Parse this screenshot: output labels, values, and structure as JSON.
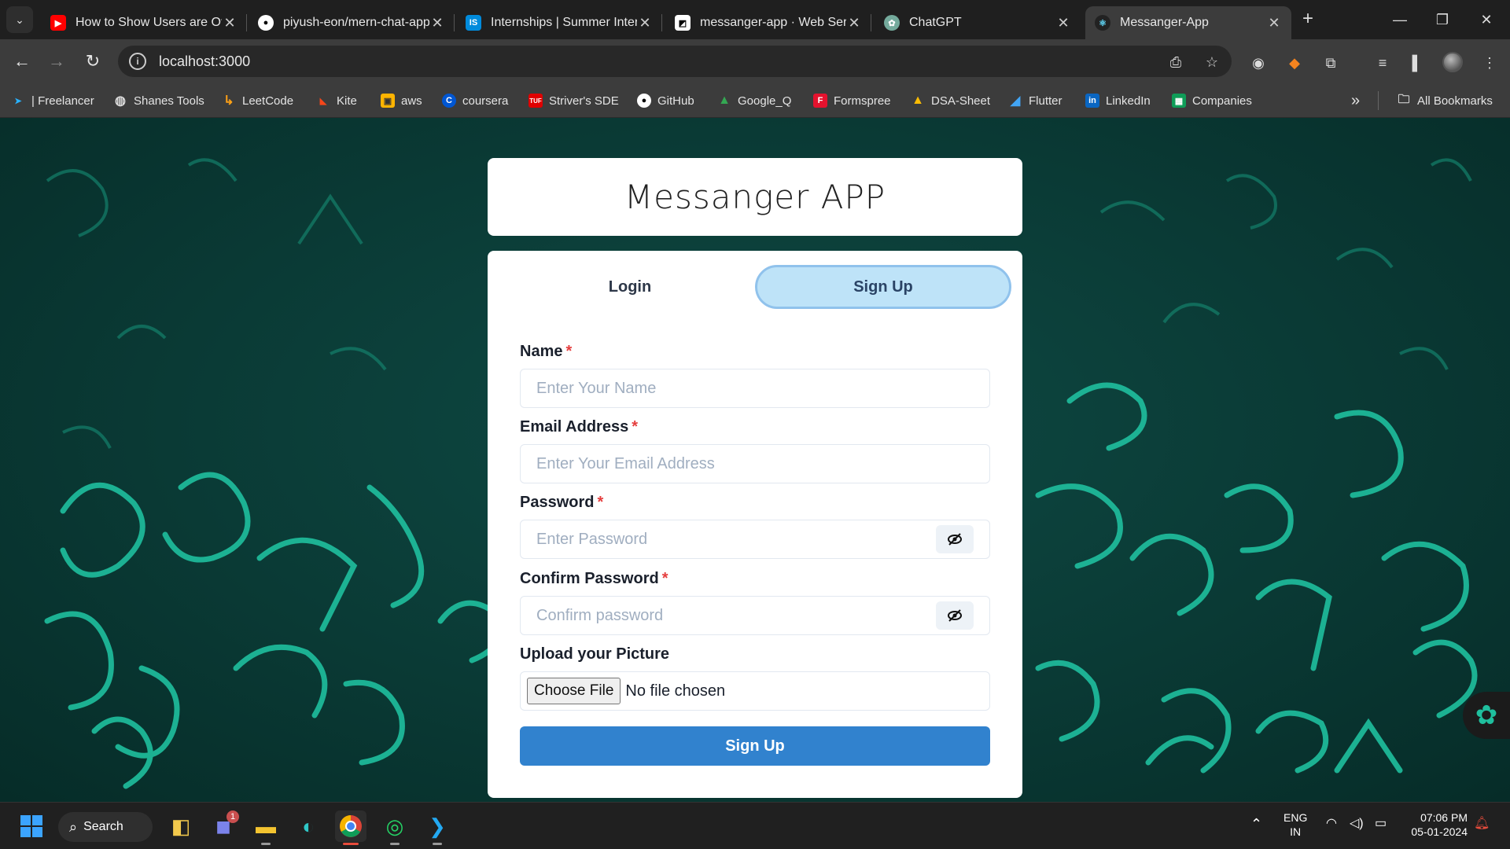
{
  "browser": {
    "tabs": [
      {
        "title": "How to Show Users are Offline",
        "favicon": "youtube-icon",
        "color": "#ff0000"
      },
      {
        "title": "piyush-eon/mern-chat-app",
        "favicon": "github-icon",
        "color": "#ffffff"
      },
      {
        "title": "Internships | Summer Internships",
        "favicon": "internshala-icon",
        "color": "#008bdc"
      },
      {
        "title": "messanger-app · Web Service",
        "favicon": "render-icon",
        "color": "#ffffff"
      },
      {
        "title": "ChatGPT",
        "favicon": "chatgpt-icon",
        "color": "#74aa9c"
      },
      {
        "title": "Messanger-App",
        "favicon": "react-icon",
        "color": "#61dafb",
        "active": true
      }
    ],
    "url": "localhost:3000",
    "bookmarks": [
      {
        "label": "| Freelancer",
        "icon": "freelancer-icon",
        "color": "#29b2fe"
      },
      {
        "label": "Shanes Tools",
        "icon": "globe-icon",
        "color": "#dddddd"
      },
      {
        "label": "LeetCode",
        "icon": "leetcode-icon",
        "color": "#ffa116"
      },
      {
        "label": "Kite",
        "icon": "kite-icon",
        "color": "#f6461a"
      },
      {
        "label": "aws",
        "icon": "aws-icon",
        "color": "#ffb400"
      },
      {
        "label": "coursera",
        "icon": "coursera-icon",
        "color": "#0056d2"
      },
      {
        "label": "Striver's SDE",
        "icon": "tuf-icon",
        "color": "#e00000"
      },
      {
        "label": "GitHub",
        "icon": "github-icon",
        "color": "#ffffff"
      },
      {
        "label": "Google_Q",
        "icon": "google-drive-icon",
        "color": "#34a853"
      },
      {
        "label": "Formspree",
        "icon": "formspree-icon",
        "color": "#e5122e"
      },
      {
        "label": "DSA-Sheet",
        "icon": "google-drive-icon",
        "color": "#fbbc04"
      },
      {
        "label": "Flutter",
        "icon": "flutter-icon",
        "color": "#42a5f5"
      },
      {
        "label": "LinkedIn",
        "icon": "linkedin-icon",
        "color": "#0a66c2"
      },
      {
        "label": "Companies",
        "icon": "sheets-icon",
        "color": "#0f9d58"
      }
    ],
    "all_bookmarks_label": "All Bookmarks",
    "overflow_label": "»"
  },
  "app": {
    "title": "Messanger APP",
    "tabs": {
      "login": "Login",
      "signup": "Sign Up"
    },
    "fields": {
      "name": {
        "label": "Name",
        "placeholder": "Enter Your Name"
      },
      "email": {
        "label": "Email Address",
        "placeholder": "Enter Your Email Address"
      },
      "password": {
        "label": "Password",
        "placeholder": "Enter Password"
      },
      "confirm": {
        "label": "Confirm Password",
        "placeholder": "Confirm password"
      },
      "picture": {
        "label": "Upload your Picture",
        "button": "Choose File",
        "status": "No file chosen"
      }
    },
    "required_mark": "*",
    "submit_label": "Sign Up"
  },
  "taskbar": {
    "search_label": "Search",
    "teams_badge": "1",
    "language": "ENG",
    "region": "IN",
    "time": "07:06 PM",
    "date": "05-01-2024"
  }
}
